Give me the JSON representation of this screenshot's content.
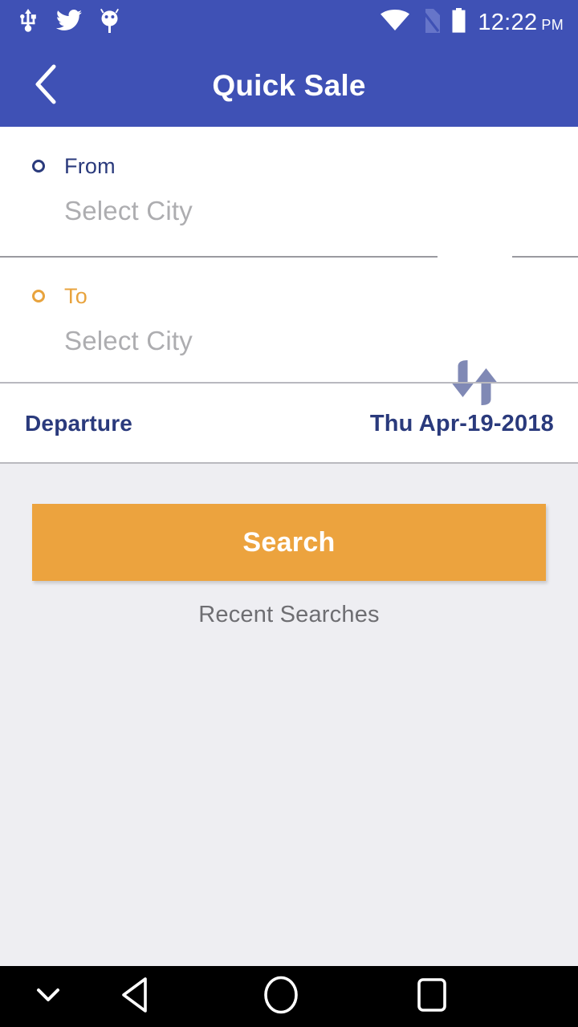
{
  "status_bar": {
    "icons_left": [
      "usb-icon",
      "twitter-icon",
      "android-bug-icon"
    ],
    "icons_right": [
      "wifi-icon",
      "no-sim-icon",
      "battery-icon"
    ],
    "time": "12:22",
    "meridiem": "PM",
    "background_color": "#3f51b5"
  },
  "app_bar": {
    "back_icon": "chevron-left-icon",
    "title": "Quick Sale",
    "background_color": "#3f51b5",
    "title_color": "#ffffff"
  },
  "form": {
    "from": {
      "label": "From",
      "label_color": "#2a3a7c",
      "marker_icon": "circle-outline-icon",
      "value": "Select City",
      "placeholder": "Select City",
      "value_color": "#adadb0"
    },
    "to": {
      "label": "To",
      "label_color": "#e8a33d",
      "marker_icon": "circle-outline-icon",
      "value": "Select City",
      "placeholder": "Select City",
      "value_color": "#adadb0"
    },
    "swap_icon": "swap-vertical-arrows-icon",
    "swap_icon_color": "#8089b5",
    "departure": {
      "label": "Departure",
      "value": "Thu Apr-19-2018",
      "color": "#2a3a7c"
    }
  },
  "actions": {
    "search_label": "Search",
    "search_color": "#eca33e",
    "recent_searches_label": "Recent Searches",
    "recent_searches_color": "#6e6e72"
  },
  "nav_bar": {
    "items": [
      "chevron-down-icon",
      "back-triangle-icon",
      "home-circle-icon",
      "recents-square-icon"
    ],
    "background_color": "#000000"
  }
}
